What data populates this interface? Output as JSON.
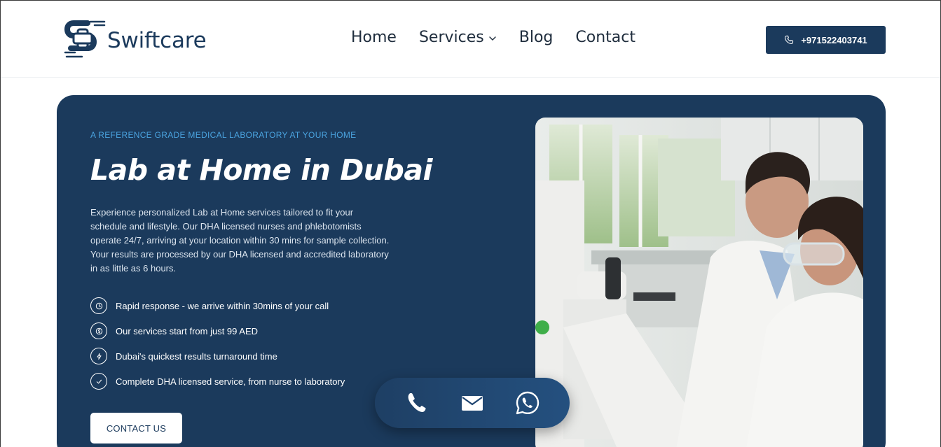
{
  "brand": {
    "name": "Swiftcare",
    "logo_icon": "swiftcare-cross-s-logo"
  },
  "nav": {
    "items": [
      {
        "label": "Home"
      },
      {
        "label": "Services",
        "has_dropdown": true
      },
      {
        "label": "Blog"
      },
      {
        "label": "Contact"
      }
    ]
  },
  "header": {
    "phone": "+971522403741",
    "phone_icon": "phone-icon"
  },
  "hero": {
    "eyebrow": "A REFERENCE GRADE MEDICAL LABORATORY AT YOUR HOME",
    "title": "Lab at Home in Dubai",
    "description": "Experience personalized Lab at Home services tailored to fit your schedule and lifestyle. Our DHA licensed nurses and phlebotomists operate 24/7, arriving at your location within 30 mins for sample collection. Your results are processed by our DHA licensed and accredited laboratory in as little as 6 hours.",
    "features": [
      {
        "icon": "clock-icon",
        "text": "Rapid response - we arrive within 30mins of your call"
      },
      {
        "icon": "dollar-icon",
        "text": "Our services start from just 99 AED"
      },
      {
        "icon": "bolt-icon",
        "text": "Dubai's quickest results turnaround time"
      },
      {
        "icon": "check-icon",
        "text": "Complete DHA licensed service, from nurse to laboratory"
      }
    ],
    "cta_label": "CONTACT US",
    "image": "lab-scientists-photo"
  },
  "floating_contact": {
    "icons": [
      "phone-icon",
      "mail-icon",
      "whatsapp-icon"
    ]
  },
  "colors": {
    "navy": "#1b3a5c",
    "accent": "#4aa3df",
    "white": "#ffffff"
  }
}
